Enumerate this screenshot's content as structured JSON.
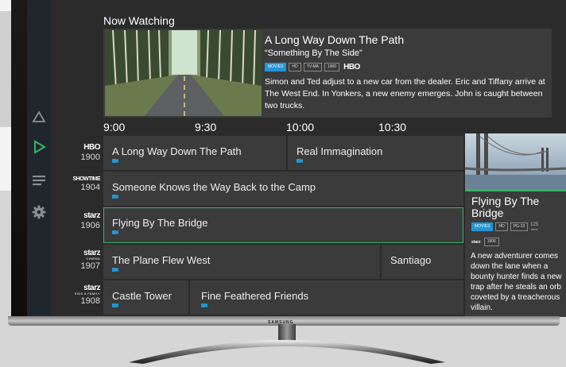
{
  "now_watching": {
    "heading": "Now Watching",
    "show_title": "A Long Way Down The Path",
    "episode": "“Something By The Side”",
    "badges": [
      "MOVIES",
      "HD",
      "TV-MA",
      "1900"
    ],
    "network": "HBO",
    "description": "Simon and Ted adjust to a new car from the dealer. Eric and Tiffany arrive at The West End. In Yonkers, a new enemy emerges. John is caught between two trucks."
  },
  "times": [
    "9:00",
    "9:30",
    "10:00",
    "10:30"
  ],
  "channels": [
    {
      "logo": "HBO",
      "sub": "",
      "number": "1900"
    },
    {
      "logo": "SHOWTIME",
      "sub": "",
      "number": "1904"
    },
    {
      "logo": "starz",
      "sub": "",
      "number": "1906"
    },
    {
      "logo": "starz",
      "sub": "CINEMA",
      "number": "1907"
    },
    {
      "logo": "starz",
      "sub": "KIDS & FAMILY",
      "number": "1908"
    }
  ],
  "guide": {
    "row1": [
      "A Long Way Down The Path",
      "Real Immagination"
    ],
    "row2": [
      "Someone Knows the Way Back to the Camp"
    ],
    "row3": [
      "Flying By The Bridge"
    ],
    "row4": [
      "The Plane Flew West",
      "Santiago"
    ],
    "row5": [
      "Castle Tower",
      "Fine Feathered Friends"
    ]
  },
  "detail": {
    "title": "Flying By The Bridge",
    "badges": [
      "MOVIES",
      "HD",
      "PG-13"
    ],
    "minutes": "125",
    "minutes_label": "mins",
    "channel_logo": "starz",
    "channel_number": "1906",
    "description": "A new adventurer comes down the lane when a bounty hunter finds a new trap after he steals an orb coveted by a treacherous villain."
  },
  "tv_brand": "SAMSUNG",
  "colors": {
    "accent_green": "#38b26a",
    "badge_blue": "#2196d6",
    "cell_bg": "#3b3b3b",
    "screen_bg": "#2b2b2b"
  },
  "icons": [
    "triangle-icon",
    "play-icon",
    "menu-icon",
    "gear-icon",
    "camera-icon"
  ]
}
